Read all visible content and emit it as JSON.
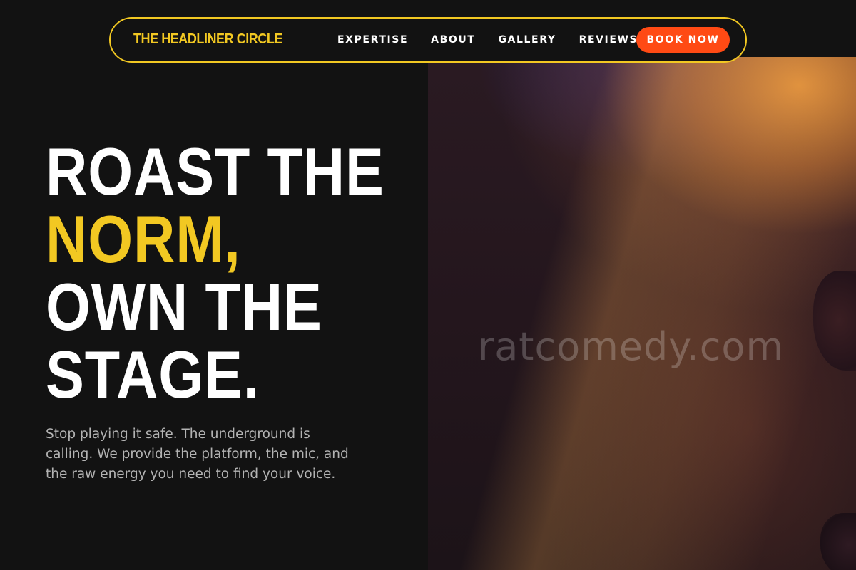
{
  "nav": {
    "brand": "THE HEADLINER CIRCLE",
    "links": [
      "EXPERTISE",
      "ABOUT",
      "GALLERY",
      "REVIEWS"
    ],
    "cta": "BOOK NOW"
  },
  "hero": {
    "headline": {
      "line1": "ROAST THE",
      "line2": "NORM,",
      "line3": "OWN THE",
      "line4": "STAGE."
    },
    "subtext": "Stop playing it safe. The underground is calling. We provide the platform, the mic, and the raw energy you need to find your voice.",
    "image_watermark": "ratcomedy.com"
  },
  "colors": {
    "background": "#121212",
    "accent_yellow": "#f2c822",
    "cta_orange": "#ff4a14",
    "text_white": "#ffffff",
    "text_muted": "#b3b3b3"
  }
}
